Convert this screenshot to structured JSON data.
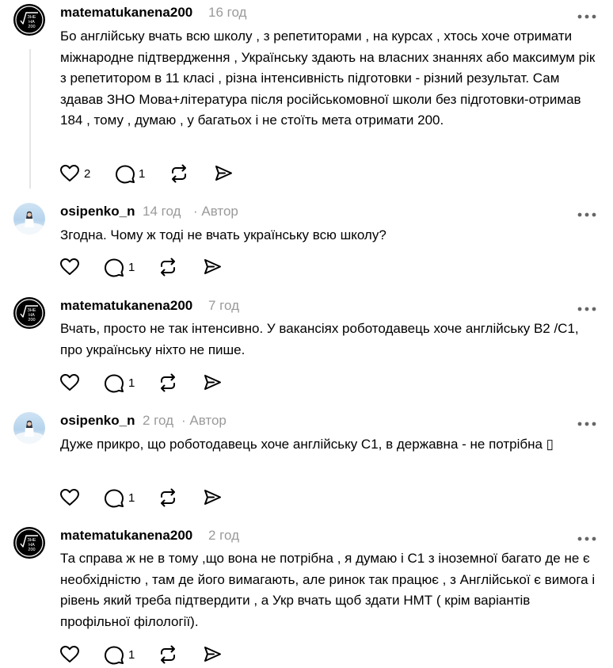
{
  "threads": [
    {
      "username": "matematukanena200",
      "time": "16 год",
      "author_label": "",
      "avatar": "logo",
      "text": "Бо англійську вчать всю школу , з репетиторами , на курсах , хтось хоче отримати міжнародне підтвердження , Українську здають на власних знаннях або максимум рік з репетитором в 11 класі , різна інтенсивність підготовки - різний результат. Сам здавав ЗНО Мова+література після російськомовної школи без підготовки-отримав 184 , тому , думаю , у багатьох і не стоїть мета отримати 200.",
      "likes": "2",
      "replies": "1"
    },
    {
      "username": "osipenko_n",
      "time": "14 год",
      "author_label": "· Автор",
      "avatar": "photo",
      "text": "Згодна. Чому ж тоді не вчать українську всю школу?",
      "likes": "",
      "replies": "1"
    },
    {
      "username": "matematukanena200",
      "time": "7 год",
      "author_label": "",
      "avatar": "logo",
      "text": "Вчать, просто не так інтенсивно. У вакансіях роботодавець хоче англійську В2 /С1, про українську ніхто не пише.",
      "likes": "",
      "replies": "1"
    },
    {
      "username": "osipenko_n",
      "time": "2 год",
      "author_label": "· Автор",
      "avatar": "photo",
      "text": "Дуже прикро, що роботодавець хоче англійську С1, в державна - не потрібна ▯",
      "likes": "",
      "replies": "1"
    },
    {
      "username": "matematukanena200",
      "time": "2 год",
      "author_label": "",
      "avatar": "logo",
      "text": "Та справа ж не в тому ,що вона не потрібна , я думаю і С1 з іноземної багато де не є необхідністю , там де його вимагають, але ринок так працює , з Англійської є вимога і рівень який треба підтвердити , а Укр вчать щоб здати НМТ ( крім варіантів профільної філології).",
      "likes": "",
      "replies": "1"
    }
  ],
  "logo_text": [
    "ЗНЕ",
    "НА",
    "200"
  ],
  "colors": {
    "muted": "#9a9a9a",
    "text": "#000000",
    "divider": "#e5e5e5"
  },
  "icons": [
    "heart-icon",
    "comment-icon",
    "repost-icon",
    "share-icon",
    "more-icon"
  ]
}
